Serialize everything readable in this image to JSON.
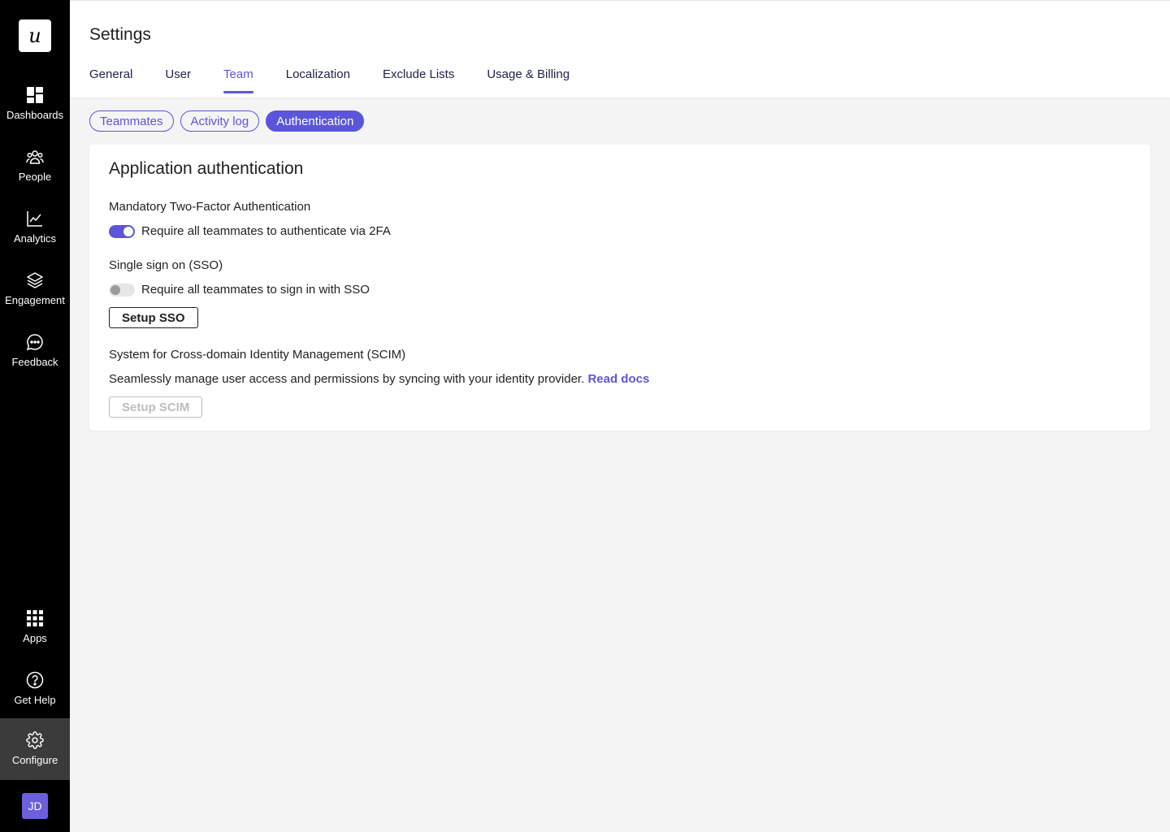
{
  "sidebar": {
    "logo_text": "u",
    "items": [
      {
        "label": "Dashboards",
        "icon": "dashboard-grid-icon"
      },
      {
        "label": "People",
        "icon": "people-icon"
      },
      {
        "label": "Analytics",
        "icon": "chart-line-icon"
      },
      {
        "label": "Engagement",
        "icon": "layers-icon"
      },
      {
        "label": "Feedback",
        "icon": "chat-bubble-icon"
      }
    ],
    "bottom_items": [
      {
        "label": "Apps",
        "icon": "apps-grid-icon"
      },
      {
        "label": "Get Help",
        "icon": "help-icon"
      },
      {
        "label": "Configure",
        "icon": "gear-icon",
        "active": true
      }
    ],
    "avatar_initials": "JD"
  },
  "header": {
    "title": "Settings",
    "tabs": [
      "General",
      "User",
      "Team",
      "Localization",
      "Exclude Lists",
      "Usage & Billing"
    ],
    "active_tab": "Team"
  },
  "subtabs": {
    "items": [
      "Teammates",
      "Activity log",
      "Authentication"
    ],
    "active": "Authentication"
  },
  "card": {
    "title": "Application authentication",
    "tfa": {
      "title": "Mandatory Two-Factor Authentication",
      "toggle_label": "Require all teammates to authenticate via 2FA",
      "enabled": true
    },
    "sso": {
      "title": "Single sign on (SSO)",
      "toggle_label": "Require all teammates to sign in with SSO",
      "enabled": false,
      "button_label": "Setup SSO"
    },
    "scim": {
      "title": "System for Cross-domain Identity Management (SCIM)",
      "description": "Seamlessly manage user access and permissions by syncing with your identity provider.",
      "link_label": "Read docs",
      "button_label": "Setup SCIM"
    }
  },
  "colors": {
    "accent": "#5b55dc",
    "sidebar_bg": "#000000",
    "page_bg": "#f4f4f4",
    "avatar_bg": "#6b5fdc"
  }
}
